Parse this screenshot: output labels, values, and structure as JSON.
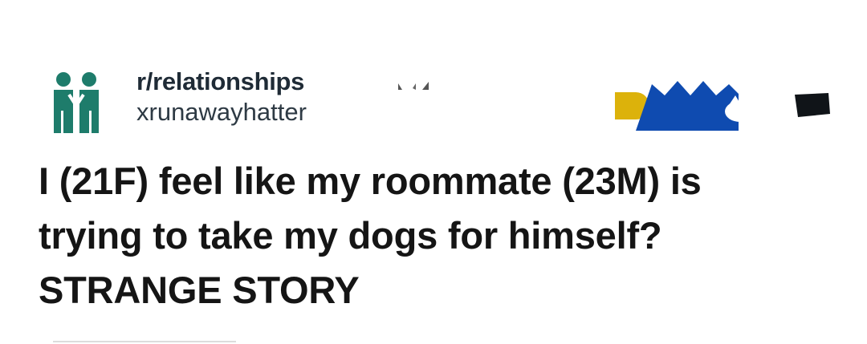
{
  "post": {
    "subreddit": "r/relationships",
    "username": "xrunawayhatter",
    "title_lines": [
      "I (21F) feel like my roommate (23M) is",
      "trying to take my dogs for himself?",
      "STRANGE STORY"
    ]
  },
  "icons": {
    "community": "two-people-icon",
    "award_1": "gold-award-icon",
    "award_2": "crown-award-icon",
    "overflow": "dark-badge-icon"
  },
  "colors": {
    "community_icon": "#1e7c6b",
    "gold": "#dcb20b",
    "blue": "#0f4bb0",
    "text": "#151515"
  }
}
